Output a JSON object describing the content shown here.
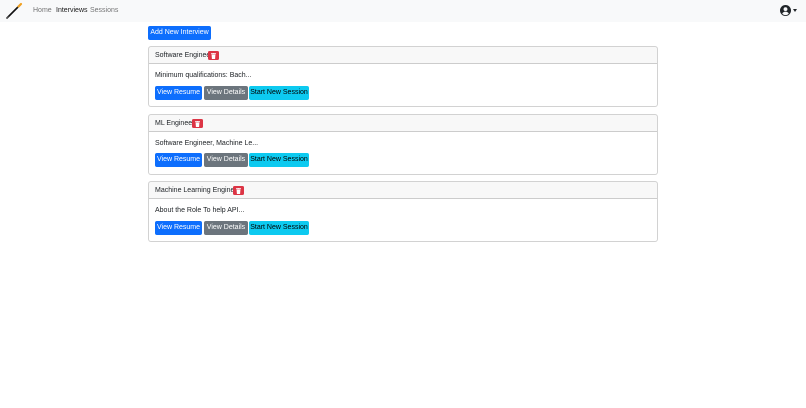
{
  "navbar": {
    "logo_icon": "pencil-logo-icon",
    "links": [
      "Home",
      "Interviews",
      "Sessions"
    ],
    "active": "Interviews",
    "user_icon": "user-circle-icon"
  },
  "actions": {
    "add_label": "Add New Interview"
  },
  "interviews": [
    {
      "title": "Software Engineer",
      "desc": "Minimum qualifications: Bach..."
    },
    {
      "title": "ML Engineer",
      "desc": "Software Engineer, Machine Le..."
    },
    {
      "title": "Machine Learning Engineer",
      "desc": "About the Role To help API..."
    }
  ],
  "card_actions": {
    "view_resume": "View Resume",
    "view_details": "View Details",
    "start_session": "Start New Session"
  },
  "colors": {
    "primary": "#0d6efd",
    "secondary": "#6c757d",
    "info": "#0dcaf0",
    "danger": "#dc3545",
    "navbar_bg": "#f8f9fa"
  }
}
